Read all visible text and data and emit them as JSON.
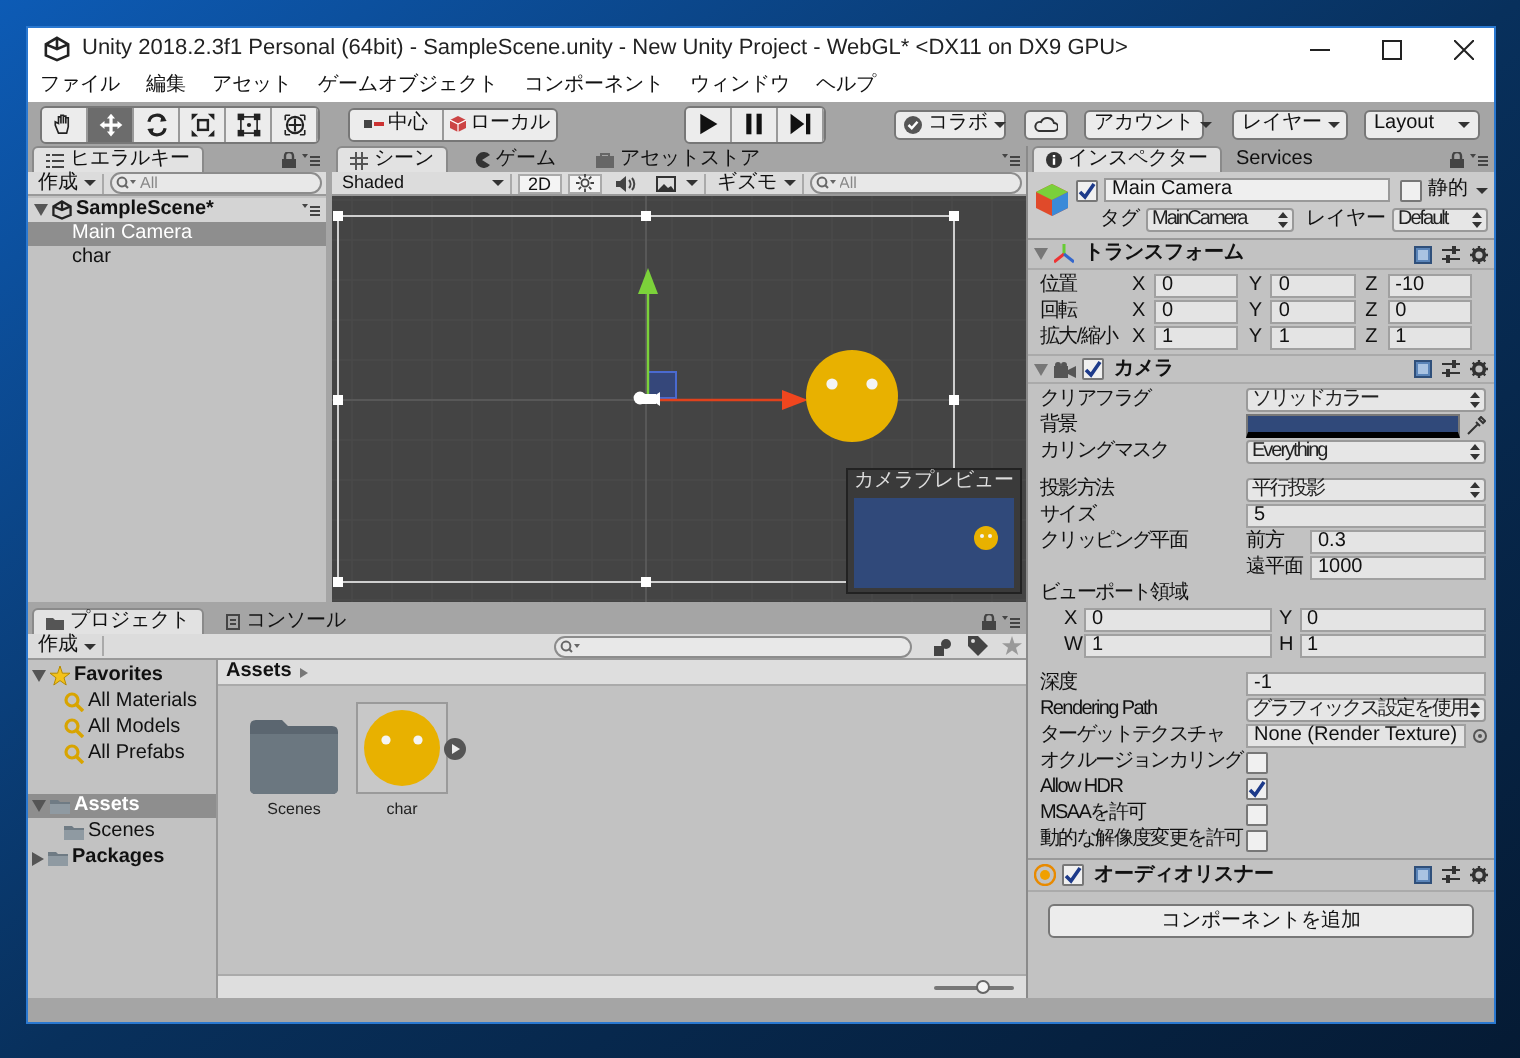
{
  "window": {
    "title": "Unity 2018.2.3f1 Personal (64bit) - SampleScene.unity - New Unity Project - WebGL* <DX11 on DX9 GPU>"
  },
  "menu": [
    "ファイル",
    "編集",
    "アセット",
    "ゲームオブジェクト",
    "コンポーネント",
    "ウィンドウ",
    "ヘルプ"
  ],
  "toolbar": {
    "tools": [
      {
        "kind": "hand",
        "selected": false
      },
      {
        "kind": "move",
        "selected": true
      },
      {
        "kind": "rotate",
        "selected": false
      },
      {
        "kind": "scale",
        "selected": false
      },
      {
        "kind": "rect",
        "selected": false
      },
      {
        "kind": "transform",
        "selected": false
      }
    ],
    "pivot": "中心",
    "space": "ローカル",
    "playback": [
      {
        "kind": "play"
      },
      {
        "kind": "pause"
      },
      {
        "kind": "step"
      }
    ],
    "collab": "コラボ",
    "account": "アカウント",
    "layers": "レイヤー",
    "layout": "Layout"
  },
  "hierarchy": {
    "tab": "ヒエラルキー",
    "create": "作成",
    "search_placeholder": "All",
    "scene": "SampleScene*",
    "items": [
      {
        "label": "Main Camera",
        "selected": true
      },
      {
        "label": "char",
        "selected": false
      }
    ]
  },
  "scene": {
    "tabs": [
      {
        "label": "シーン",
        "selected": true
      },
      {
        "label": "ゲーム",
        "selected": false
      },
      {
        "label": "アセットストア",
        "selected": false
      }
    ],
    "shading": "Shaded",
    "mode_2d": "2D",
    "lighting_on": true,
    "audio_on": false,
    "gizmos": "ギズモ",
    "search_placeholder": "All",
    "camera_preview": {
      "title": "カメラプレビュー"
    }
  },
  "project": {
    "tabs": [
      {
        "label": "プロジェクト",
        "selected": true
      },
      {
        "label": "コンソール",
        "selected": false
      }
    ],
    "create": "作成",
    "tree": [
      {
        "kind": "favorites",
        "label": "Favorites",
        "expanded": true,
        "selected": false,
        "children": [
          {
            "kind": "search",
            "label": "All Materials",
            "selected": false
          },
          {
            "kind": "search",
            "label": "All Models",
            "selected": false
          },
          {
            "kind": "search",
            "label": "All Prefabs",
            "selected": false
          }
        ]
      },
      {
        "kind": "folder",
        "label": "Assets",
        "expanded": true,
        "selected": true,
        "children": [
          {
            "kind": "folder",
            "label": "Scenes",
            "selected": false
          }
        ]
      },
      {
        "kind": "folder",
        "label": "Packages",
        "expanded": false,
        "selected": false
      }
    ],
    "breadcrumb": "Assets",
    "assets": [
      {
        "kind": "folder",
        "label": "Scenes"
      },
      {
        "kind": "sprite",
        "label": "char"
      }
    ],
    "thumbnail_size": {
      "level": 0.6
    }
  },
  "inspector": {
    "tabs": [
      {
        "label": "インスペクター",
        "selected": true
      },
      {
        "label": "Services",
        "selected": false
      }
    ],
    "object": {
      "name": "Main Camera",
      "active": true,
      "static_label": "静的",
      "static": false,
      "tag_label": "タグ",
      "tag": "MainCamera",
      "layer_label": "レイヤー",
      "layer": "Default"
    },
    "transform": {
      "title": "トランスフォーム",
      "rows": [
        {
          "label": "位置",
          "fields": [
            {
              "axis": "X",
              "value": "0"
            },
            {
              "axis": "Y",
              "value": "0"
            },
            {
              "axis": "Z",
              "value": "-10"
            }
          ]
        },
        {
          "label": "回転",
          "fields": [
            {
              "axis": "X",
              "value": "0"
            },
            {
              "axis": "Y",
              "value": "0"
            },
            {
              "axis": "Z",
              "value": "0"
            }
          ]
        },
        {
          "label": "拡大/縮小",
          "fields": [
            {
              "axis": "X",
              "value": "1"
            },
            {
              "axis": "Y",
              "value": "1"
            },
            {
              "axis": "Z",
              "value": "1"
            }
          ]
        }
      ]
    },
    "camera": {
      "title": "カメラ",
      "enabled": true,
      "groups": [
        [
          {
            "kind": "dropdown",
            "label": "クリアフラグ",
            "value": "ソリッドカラー"
          },
          {
            "kind": "color",
            "label": "背景",
            "color": "#30497a"
          },
          {
            "kind": "dropdown",
            "label": "カリングマスク",
            "value": "Everything"
          }
        ],
        [
          {
            "kind": "dropdown",
            "label": "投影方法",
            "value": "平行投影"
          },
          {
            "kind": "text",
            "label": "サイズ",
            "value": "5"
          },
          {
            "kind": "pair",
            "label": "クリッピング平面",
            "items": [
              {
                "label": "前方",
                "value": "0.3"
              },
              {
                "label": "遠平面",
                "value": "1000"
              }
            ]
          },
          {
            "kind": "rect",
            "label": "ビューポート領域",
            "items": [
              {
                "label": "X",
                "value": "0"
              },
              {
                "label": "Y",
                "value": "0"
              },
              {
                "label": "W",
                "value": "1"
              },
              {
                "label": "H",
                "value": "1"
              }
            ]
          }
        ],
        [
          {
            "kind": "text",
            "label": "深度",
            "value": "-1"
          },
          {
            "kind": "dropdown",
            "label": "Rendering Path",
            "value": "グラフィックス設定を使用"
          },
          {
            "kind": "object",
            "label": "ターゲットテクスチャ",
            "value": "None (Render Texture)"
          },
          {
            "kind": "checkbox",
            "label": "オクルージョンカリング",
            "checked": false
          },
          {
            "kind": "checkbox",
            "label": "Allow HDR",
            "checked": true
          },
          {
            "kind": "checkbox",
            "label": "MSAAを許可",
            "checked": false
          },
          {
            "kind": "checkbox",
            "label": "動的な解像度変更を許可",
            "checked": false
          }
        ]
      ]
    },
    "audio_listener": {
      "title": "オーディオリスナー",
      "enabled": true
    },
    "add_component": "コンポーネントを追加"
  }
}
